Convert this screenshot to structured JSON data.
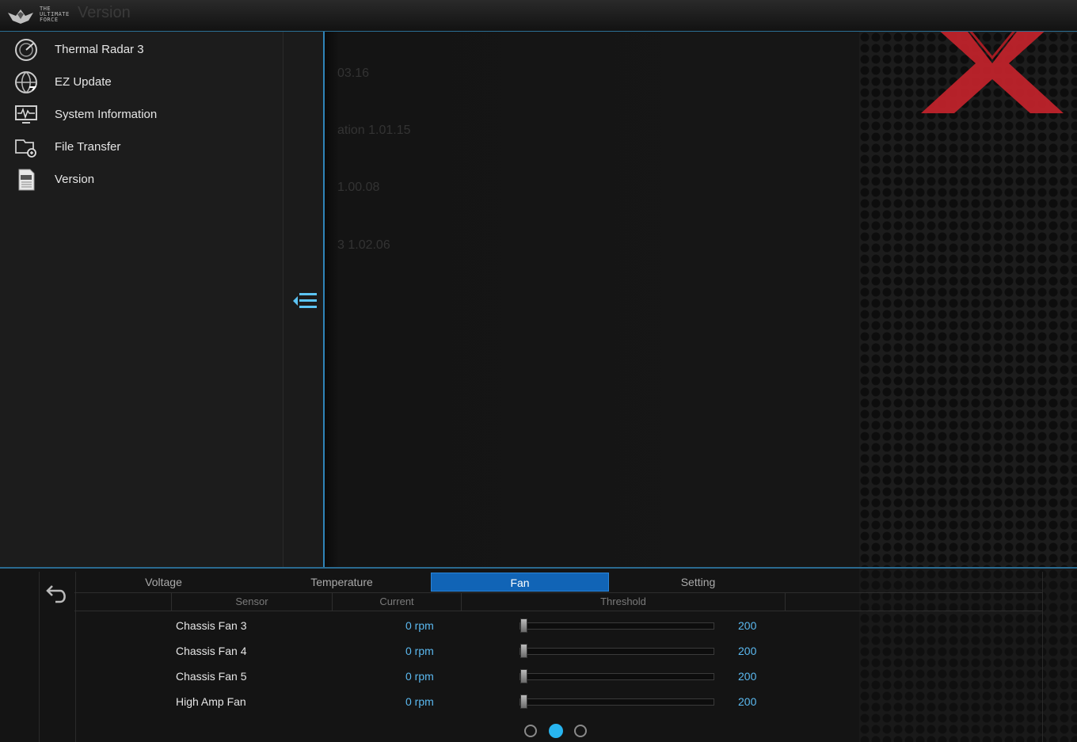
{
  "titlebar": {
    "logo_lines": [
      "THE",
      "ULTIMATE",
      "FORCE"
    ],
    "page_title": "Version"
  },
  "sidebar": {
    "items": [
      {
        "label": "Thermal Radar 3",
        "icon": "thermal-radar-icon"
      },
      {
        "label": "EZ Update",
        "icon": "globe-update-icon"
      },
      {
        "label": "System Information",
        "icon": "system-monitor-icon"
      },
      {
        "label": "File Transfer",
        "icon": "file-transfer-icon"
      },
      {
        "label": "Version",
        "icon": "version-doc-icon"
      }
    ]
  },
  "main": {
    "faded_lines": [
      "03.16",
      "ation   1.01.15",
      "1.00.08",
      "3    1.02.06"
    ]
  },
  "bottom": {
    "tabs": [
      "Voltage",
      "Temperature",
      "Fan",
      "Setting"
    ],
    "active_tab": "Fan",
    "columns": [
      "Sensor",
      "Current",
      "Threshold"
    ],
    "rows": [
      {
        "sensor": "Chassis Fan 3",
        "current": "0 rpm",
        "threshold": "200",
        "level": 0
      },
      {
        "sensor": "Chassis Fan 4",
        "current": "0 rpm",
        "threshold": "200",
        "level": 0
      },
      {
        "sensor": "Chassis Fan 5",
        "current": "0 rpm",
        "threshold": "200",
        "level": 0
      },
      {
        "sensor": "High Amp Fan",
        "current": "0 rpm",
        "threshold": "200",
        "level": 0
      }
    ],
    "pages": 3,
    "active_page": 2
  },
  "colors": {
    "accent": "#1164b6",
    "value": "#5bb9f0",
    "watermark": "#c8242c"
  }
}
